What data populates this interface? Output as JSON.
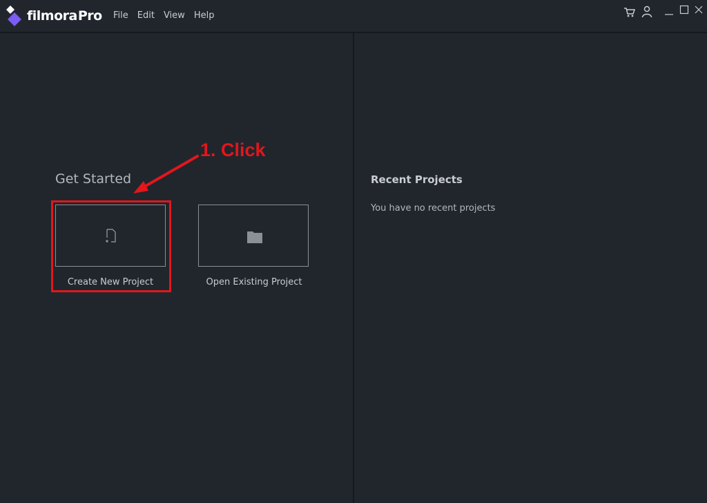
{
  "app": {
    "brand_part1": "filmora",
    "brand_part2": "Pro",
    "accent": "#7b5cf5"
  },
  "menu": {
    "items": [
      {
        "label": "File"
      },
      {
        "label": "Edit"
      },
      {
        "label": "View"
      },
      {
        "label": "Help"
      }
    ]
  },
  "window_controls": {
    "icons": [
      "cart-icon",
      "user-icon",
      "minimize-icon",
      "maximize-icon",
      "close-icon"
    ]
  },
  "get_started": {
    "title": "Get Started",
    "create": {
      "label": "Create New Project",
      "icon": "new-document-icon"
    },
    "open": {
      "label": "Open Existing Project",
      "icon": "folder-icon"
    }
  },
  "recent": {
    "title": "Recent Projects",
    "empty_text": "You have no recent projects"
  },
  "annotation": {
    "text": "1. Click",
    "color": "#e3161c"
  }
}
